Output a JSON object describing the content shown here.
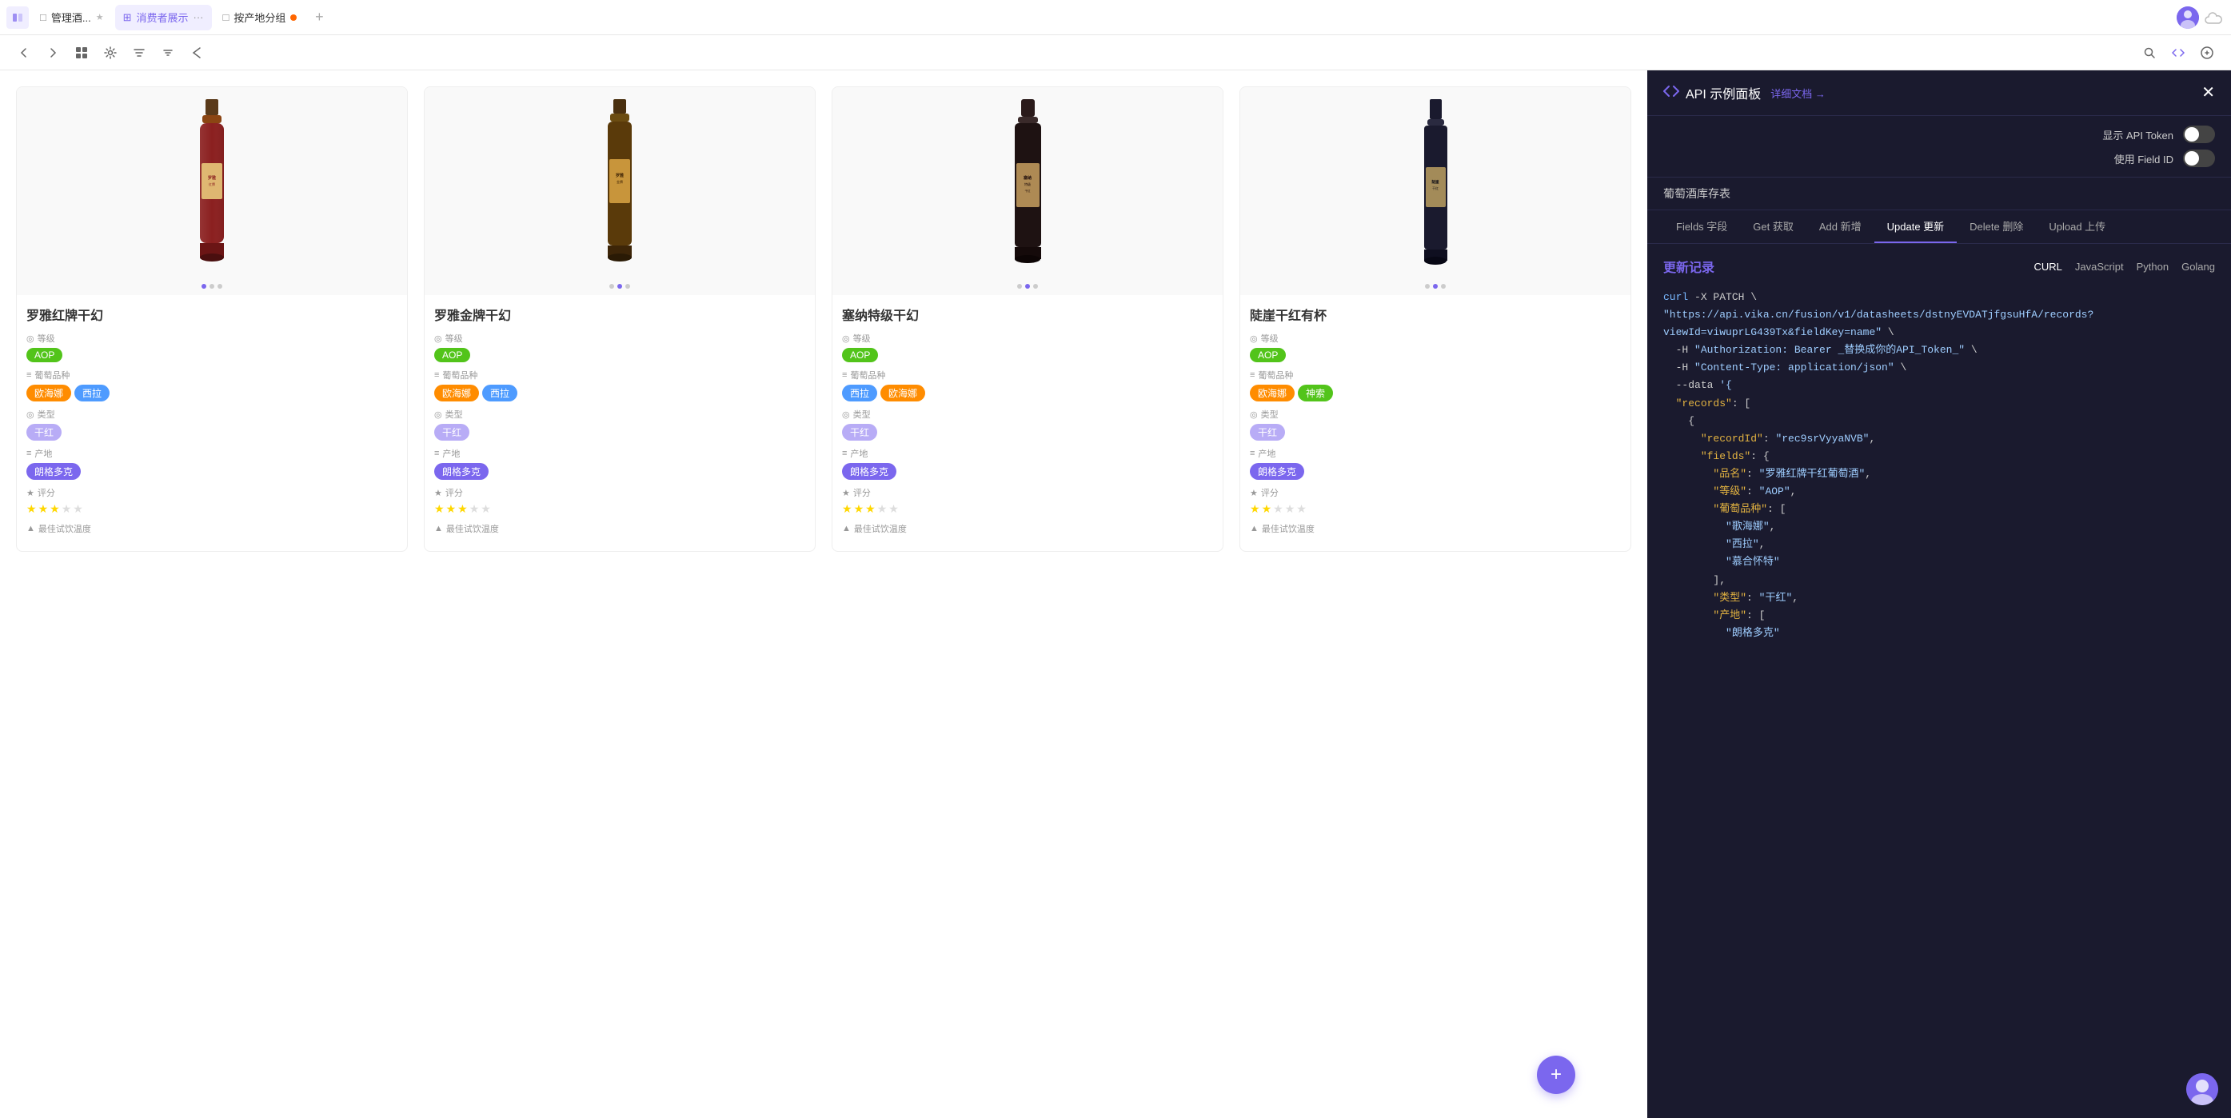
{
  "topNav": {
    "collapseIcon": "◀▶",
    "tabs": [
      {
        "id": "manage",
        "label": "管理酒...",
        "icon": "□",
        "active": false,
        "starred": true
      },
      {
        "id": "consumer",
        "label": "消费者展示",
        "icon": "⊞",
        "active": true,
        "starred": false
      },
      {
        "id": "region",
        "label": "按产地分组",
        "icon": "□",
        "active": false,
        "starred": false
      }
    ],
    "plusLabel": "+",
    "moreIcon": "···"
  },
  "toolbar": {
    "backIcon": "←",
    "forwardIcon": "→",
    "gridIcon": "⊞",
    "settingsIcon": "⚙",
    "filterIcon": "▽",
    "sortIcon": "↕",
    "shareIcon": "➤",
    "searchIcon": "🔍",
    "codeIcon": "</>",
    "moreIcon": "⊕"
  },
  "wines": [
    {
      "id": 1,
      "name": "罗雅红牌干幻",
      "grade_label": "等级",
      "grade": "AOP",
      "grape_label": "葡萄品种",
      "grapes": [
        "欧海娜",
        "西拉"
      ],
      "type_label": "类型",
      "type": "干红",
      "region_label": "产地",
      "region": "朗格多克",
      "rating_label": "评分",
      "stars": 3,
      "temp_label": "最佳试饮温度",
      "dots": [
        true,
        false,
        false
      ],
      "bottleColor": "#8B2020"
    },
    {
      "id": 2,
      "name": "罗雅金牌干幻",
      "grade_label": "等级",
      "grade": "AOP",
      "grape_label": "葡萄品种",
      "grapes": [
        "欧海娜",
        "西拉"
      ],
      "type_label": "类型",
      "type": "干红",
      "region_label": "产地",
      "region": "朗格多克",
      "rating_label": "评分",
      "stars": 3,
      "temp_label": "最佳试饮温度",
      "dots": [
        false,
        true,
        false
      ],
      "bottleColor": "#6B4C11"
    },
    {
      "id": 3,
      "name": "塞纳特级干幻",
      "grade_label": "等级",
      "grade": "AOP",
      "grape_label": "葡萄品种",
      "grapes": [
        "西拉",
        "欧海娜"
      ],
      "type_label": "类型",
      "type": "干红",
      "region_label": "产地",
      "region": "朗格多克",
      "rating_label": "评分",
      "stars": 3,
      "temp_label": "最佳试饮温度",
      "dots": [
        false,
        true,
        false
      ],
      "bottleColor": "#2a1a1a"
    },
    {
      "id": 4,
      "name": "陡崖干红有杯",
      "grade_label": "等级",
      "grade": "AOP",
      "grape_label": "葡萄品种",
      "grapes": [
        "欧海娜",
        "神索"
      ],
      "type_label": "类型",
      "type": "干红",
      "region_label": "产地",
      "region": "朗格多克",
      "rating_label": "评分",
      "stars": 2,
      "temp_label": "最佳试饮温度",
      "dots": [
        false,
        true,
        false
      ],
      "bottleColor": "#1a1a2a"
    }
  ],
  "fabIcon": "+",
  "apiPanel": {
    "titleIcon": "</>",
    "title": "API 示例面板",
    "docsLabel": "详细文档 →",
    "closeIcon": "✕",
    "showTokenLabel": "显示 API Token",
    "useFieldIdLabel": "使用 Field ID",
    "subtitle": "葡萄酒库存表",
    "tabs": [
      {
        "id": "fields",
        "label": "Fields 字段",
        "active": false
      },
      {
        "id": "get",
        "label": "Get 获取",
        "active": false
      },
      {
        "id": "add",
        "label": "Add 新增",
        "active": false
      },
      {
        "id": "update",
        "label": "Update 更新",
        "active": true
      },
      {
        "id": "delete",
        "label": "Delete 删除",
        "active": false
      },
      {
        "id": "upload",
        "label": "Upload 上传",
        "active": false
      }
    ],
    "codeTitle": "更新记录",
    "langTabs": [
      {
        "id": "curl",
        "label": "CURL",
        "active": true
      },
      {
        "id": "js",
        "label": "JavaScript",
        "active": false
      },
      {
        "id": "python",
        "label": "Python",
        "active": false
      },
      {
        "id": "golang",
        "label": "Golang",
        "active": false
      }
    ],
    "codeLines": [
      "curl -X PATCH \\",
      "\"https://api.vika.cn/fusion/v1/datasheets/dstnyEVDATjfgsuHfA/records?",
      "viewId=viwuprLG439Tx&fieldKey=name\" \\",
      "  -H \"Authorization: Bearer _替换成你的API_Token_\" \\",
      "  -H \"Content-Type: application/json\" \\",
      "  --data '{",
      "  \"records\": [",
      "    {",
      "      \"recordId\": \"rec9srVyyaNVB\",",
      "      \"fields\": {",
      "        \"品名\": \"罗雅红牌干红葡萄酒\",",
      "        \"等级\": \"AOP\",",
      "        \"葡萄品种\": [",
      "          \"歌海娜\",",
      "          \"西拉\",",
      "          \"慕合怀特\"",
      "        ],",
      "        \"类型\": \"干红\",",
      "        \"产地\": [",
      "          \"朗格多克\""
    ]
  }
}
